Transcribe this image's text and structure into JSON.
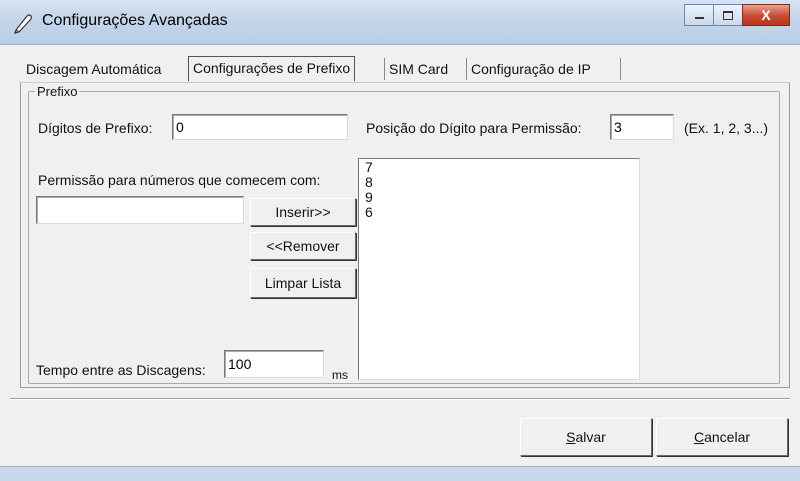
{
  "window": {
    "title": "Configurações Avançadas",
    "controls": [
      "minimize",
      "maximize",
      "close"
    ],
    "close_glyph": "X"
  },
  "tabs": [
    {
      "label": "Discagem Automática",
      "active": false
    },
    {
      "label": "Configurações de Prefixo",
      "active": true
    },
    {
      "label": "SIM Card",
      "active": false
    },
    {
      "label": "Configuração de IP",
      "active": false
    }
  ],
  "prefix": {
    "group_title": "Prefixo",
    "digits_label": "Dígitos de Prefixo:",
    "digits_value": "0",
    "position_label": "Posição do Dígito para Permissão:",
    "position_value": "3",
    "example_hint": "(Ex. 1, 2, 3...)",
    "permission_label": "Permissão para números que comecem com:",
    "permission_input_value": "",
    "insert_button": "Inserir>>",
    "remove_button": "<<Remover",
    "clear_button": "Limpar Lista",
    "allowed_list": [
      "7",
      "8",
      "9",
      "6"
    ],
    "interval_label": "Tempo entre as Discagens:",
    "interval_value": "100",
    "interval_unit": "ms"
  },
  "footer": {
    "save_button": "Salvar",
    "cancel_button": "Cancelar"
  },
  "colors": {
    "titlebar": "#c3d5ea",
    "close_button": "#c84b34",
    "window_bg": "#f0f0f0"
  }
}
